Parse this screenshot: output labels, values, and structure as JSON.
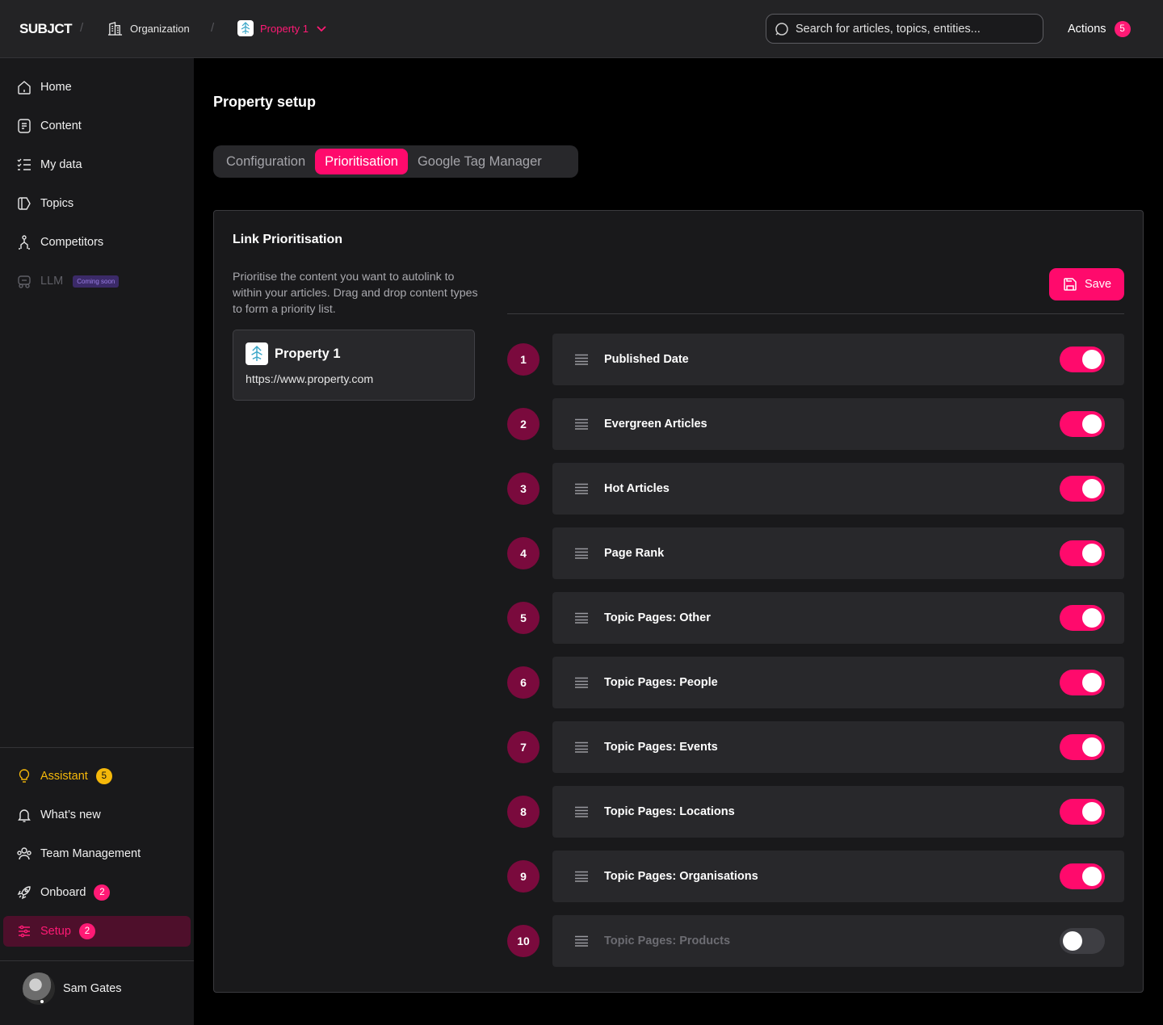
{
  "topbar": {
    "logo": "SUBJCT",
    "separator": "/",
    "organization": "Organization",
    "property": "Property 1",
    "search_placeholder": "Search for articles, topics, entities...",
    "actions_label": "Actions",
    "actions_count": "5"
  },
  "sidebar": {
    "home": "Home",
    "content": "Content",
    "my_data": "My data",
    "topics": "Topics",
    "competitors": "Competitors",
    "llm": "LLM",
    "llm_badge": "Coming soon",
    "assistant": "Assistant",
    "assistant_count": "5",
    "whats_new": "What’s new",
    "team_management": "Team Management",
    "onboard": "Onboard",
    "onboard_count": "2",
    "setup": "Setup",
    "setup_count": "2",
    "user_name": "Sam Gates"
  },
  "main": {
    "title": "Property setup",
    "tabs": [
      {
        "label": "Configuration",
        "active": false
      },
      {
        "label": "Prioritisation",
        "active": true
      },
      {
        "label": "Google Tag Manager",
        "active": false
      }
    ],
    "card_title": "Link Prioritisation",
    "description": "Prioritise the content you want to autolink to within your articles. Drag and drop content types to form a priority list.",
    "property_name": "Property 1",
    "property_url": "https://www.property.com",
    "save_label": "Save",
    "items": [
      {
        "rank": "1",
        "label": "Published Date",
        "enabled": true
      },
      {
        "rank": "2",
        "label": "Evergreen Articles",
        "enabled": true
      },
      {
        "rank": "3",
        "label": "Hot Articles",
        "enabled": true
      },
      {
        "rank": "4",
        "label": "Page Rank",
        "enabled": true
      },
      {
        "rank": "5",
        "label": "Topic Pages: Other",
        "enabled": true
      },
      {
        "rank": "6",
        "label": "Topic Pages: People",
        "enabled": true
      },
      {
        "rank": "7",
        "label": "Topic Pages: Events",
        "enabled": true
      },
      {
        "rank": "8",
        "label": "Topic Pages: Locations",
        "enabled": true
      },
      {
        "rank": "9",
        "label": "Topic Pages: Organisations",
        "enabled": true
      },
      {
        "rank": "10",
        "label": "Topic Pages: Products",
        "enabled": false
      }
    ]
  },
  "colors": {
    "accent": "#ff0a6c",
    "rank_bg": "#7a0a3d",
    "assistant": "#f5b80a",
    "active_nav_bg": "#4e0f2b"
  },
  "icons": [
    "building-icon",
    "property-logo-icon",
    "chevron-down-icon",
    "search-icon",
    "home-icon",
    "content-icon",
    "list-icon",
    "tag-icon",
    "competitors-icon",
    "llm-icon",
    "lightbulb-icon",
    "bell-icon",
    "team-icon",
    "rocket-icon",
    "sliders-icon",
    "save-icon",
    "drag-handle-icon"
  ]
}
